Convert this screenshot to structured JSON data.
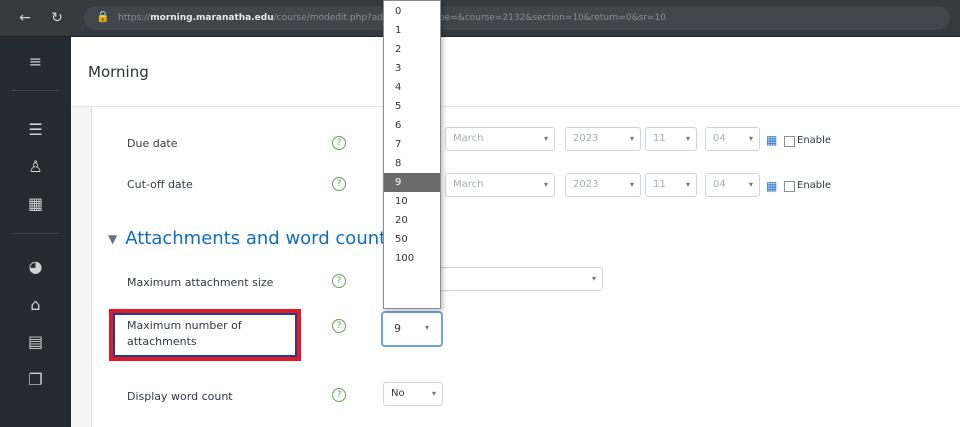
{
  "browser": {
    "url_prefix": "https://",
    "url_domain": "morning.maranatha.edu",
    "url_rest": "/course/modedit.php?add=forum&type=&course=2132&section=10&return=0&sr=10"
  },
  "header": {
    "title": "Morning"
  },
  "sidebar": {
    "icons": [
      "menu-icon",
      "list-icon",
      "users-icon",
      "grid-icon",
      "dashboard-icon",
      "home-icon",
      "calendar-icon",
      "files-icon"
    ]
  },
  "form": {
    "due_date": {
      "label": "Due date",
      "month": "March",
      "year": "2023",
      "hour": "11",
      "minute": "04",
      "enable_label": "Enable"
    },
    "cutoff_date": {
      "label": "Cut-off date",
      "month": "March",
      "year": "2023",
      "hour": "11",
      "minute": "04",
      "enable_label": "Enable"
    },
    "section_title": "Attachments and word count",
    "max_attachment_size": {
      "label": "Maximum attachment size",
      "value": ""
    },
    "max_attachments": {
      "label_line1": "Maximum number of",
      "label_line2": "attachments",
      "value": "9"
    },
    "word_count": {
      "label": "Display word count",
      "value": "No"
    }
  },
  "dropdown": {
    "options": [
      "0",
      "1",
      "2",
      "3",
      "4",
      "5",
      "6",
      "7",
      "8",
      "9",
      "10",
      "20",
      "50",
      "100"
    ],
    "selected": "9"
  },
  "colors": {
    "sidebar": "#232a31",
    "chrome": "#343a40",
    "link_blue": "#0f6cbf",
    "highlight_red": "#e2192a",
    "highlight_blue": "#1e3f8a",
    "help_green": "#6a9c5c"
  }
}
